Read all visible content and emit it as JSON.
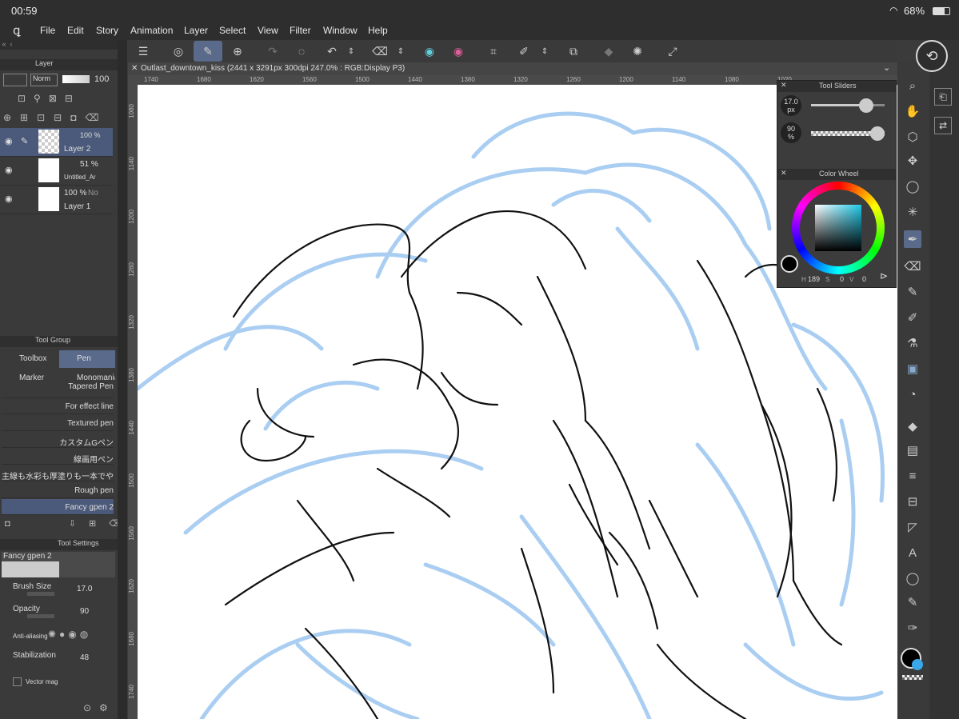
{
  "status": {
    "time": "00:59",
    "battery": "68%"
  },
  "menu": [
    "File",
    "Edit",
    "Story",
    "Animation",
    "Layer",
    "Select",
    "View",
    "Filter",
    "Window",
    "Help"
  ],
  "doc": {
    "title": "Outlast_downtown_kiss (2441 x 3291px 300dpi 247.0% : RGB:Display P3)"
  },
  "ruler": {
    "top": [
      "1740",
      "1680",
      "1620",
      "1560",
      "1500",
      "1440",
      "1380",
      "1320",
      "1260",
      "1200",
      "1140",
      "1080",
      "1020"
    ],
    "left": [
      "1080",
      "1140",
      "1200",
      "1260",
      "1320",
      "1380",
      "1440",
      "1500",
      "1560",
      "1620",
      "1680",
      "1740"
    ]
  },
  "layer_panel": {
    "title": "Layer",
    "blend": "Norm",
    "opacity": "100",
    "layers": [
      {
        "pct": "100 %",
        "name": "Layer 2"
      },
      {
        "pct": "51 %",
        "name": "Untitled_Ar"
      },
      {
        "pct": "100 %",
        "mode": "No",
        "name": "Layer 1"
      }
    ]
  },
  "tool_group": {
    "title": "Tool Group",
    "tabs": [
      "Toolbox",
      "Pen",
      "Marker",
      "Monomania"
    ],
    "brushes": [
      "Tapered Pen",
      "For effect line",
      "Textured pen",
      "カスタムGペン",
      "線画用ペン",
      "主線も水彩も厚塗りも一本でやる",
      "Rough pen",
      "Fancy gpen 2"
    ]
  },
  "tool_settings": {
    "title": "Tool Settings",
    "preset": "Fancy gpen 2",
    "brush_size_label": "Brush Size",
    "brush_size": "17.0",
    "opacity_label": "Opacity",
    "opacity": "90",
    "aa_label": "Anti-aliasing",
    "stab_label": "Stabilization",
    "stab": "48",
    "vector_label": "Vector mag"
  },
  "tool_sliders": {
    "title": "Tool Sliders",
    "size": "17.0",
    "size_unit": "px",
    "opacity": "90",
    "opacity_unit": "%",
    "size_level": 0.75,
    "opacity_level": 0.9
  },
  "color_wheel": {
    "title": "Color Wheel",
    "h": "189",
    "s": "0",
    "v": "0",
    "h_label": "H",
    "s_label": "S",
    "v_label": "V",
    "fg": "#000000",
    "bg": "#3aa8e8"
  }
}
